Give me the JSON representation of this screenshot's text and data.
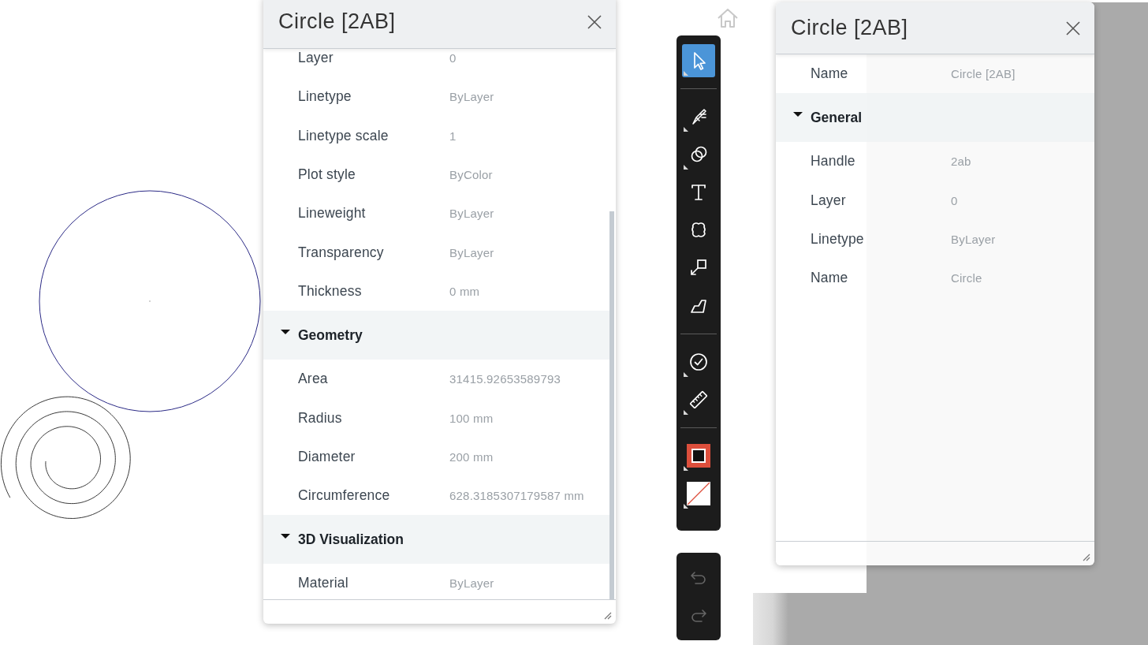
{
  "left_panel": {
    "title": "Circle [2AB]",
    "rows": [
      {
        "kind": "property",
        "label": "Layer",
        "value": "0"
      },
      {
        "kind": "property",
        "label": "Linetype",
        "value": "ByLayer"
      },
      {
        "kind": "property",
        "label": "Linetype scale",
        "value": "1"
      },
      {
        "kind": "property",
        "label": "Plot style",
        "value": "ByColor"
      },
      {
        "kind": "property",
        "label": "Lineweight",
        "value": "ByLayer"
      },
      {
        "kind": "property",
        "label": "Transparency",
        "value": "ByLayer"
      },
      {
        "kind": "property",
        "label": "Thickness",
        "value": "0 mm"
      },
      {
        "kind": "section",
        "label": "Geometry",
        "expanded": true
      },
      {
        "kind": "property",
        "label": "Area",
        "value": "31415.92653589793"
      },
      {
        "kind": "property",
        "label": "Radius",
        "value": "100 mm"
      },
      {
        "kind": "property",
        "label": "Diameter",
        "value": "200 mm"
      },
      {
        "kind": "property",
        "label": "Circumference",
        "value": "628.3185307179587 mm"
      },
      {
        "kind": "section",
        "label": "3D Visualization",
        "expanded": true
      },
      {
        "kind": "property",
        "label": "Material",
        "value": "ByLayer"
      }
    ]
  },
  "toolbar": {
    "tools": [
      {
        "kind": "select",
        "selected": true,
        "flyout": true
      },
      {
        "kind": "divider"
      },
      {
        "kind": "draw",
        "selected": false,
        "flyout": true
      },
      {
        "kind": "shapes",
        "selected": false,
        "flyout": true
      },
      {
        "kind": "text",
        "selected": false,
        "flyout": false
      },
      {
        "kind": "cloud",
        "selected": false,
        "flyout": false
      },
      {
        "kind": "callout",
        "selected": false,
        "flyout": false
      },
      {
        "kind": "polygon",
        "selected": false,
        "flyout": false
      },
      {
        "kind": "divider"
      },
      {
        "kind": "check",
        "selected": false,
        "flyout": true
      },
      {
        "kind": "measure",
        "selected": false,
        "flyout": true
      },
      {
        "kind": "divider"
      },
      {
        "kind": "stroke",
        "selected": false,
        "flyout": true
      },
      {
        "kind": "fill",
        "selected": false,
        "flyout": true
      }
    ]
  },
  "history": [
    {
      "kind": "undo",
      "disabled": true
    },
    {
      "kind": "redo",
      "disabled": true
    }
  ],
  "right_panel": {
    "title": "Circle [2AB]",
    "rows": [
      {
        "kind": "property",
        "label": "Name",
        "value": "Circle [2AB]"
      },
      {
        "kind": "section",
        "label": "General",
        "expanded": true
      },
      {
        "kind": "property",
        "label": "Handle",
        "value": "2ab"
      },
      {
        "kind": "property",
        "label": "Layer",
        "value": "0"
      },
      {
        "kind": "property",
        "label": "Linetype",
        "value": "ByLayer"
      },
      {
        "kind": "property",
        "label": "Name",
        "value": "Circle"
      }
    ]
  }
}
